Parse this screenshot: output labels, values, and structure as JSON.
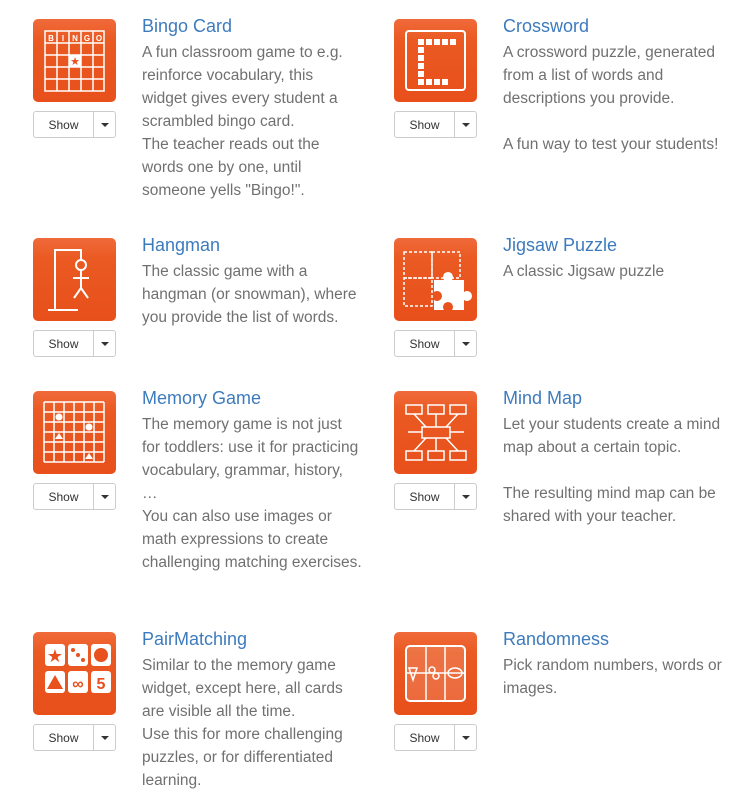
{
  "colors": {
    "accent": "#e8501d",
    "title": "#3d7bbd",
    "text": "#707070"
  },
  "widgets": [
    {
      "title": "Bingo Card",
      "icon": "bingo-card-icon",
      "button": "Show",
      "desc": [
        "A fun classroom game to e.g. reinforce vocabulary, this widget gives every student a scrambled bingo card.",
        "The teacher reads out the words one by one, until someone yells \"Bingo!\"."
      ]
    },
    {
      "title": "Crossword",
      "icon": "crossword-icon",
      "button": "Show",
      "desc": [
        "A crossword puzzle, generated from a list of words and descriptions you provide.",
        "",
        "A fun way to test your students!"
      ]
    },
    {
      "title": "Hangman",
      "icon": "hangman-icon",
      "button": "Show",
      "desc": [
        "The classic game with a hangman (or snowman), where you provide the list of words."
      ]
    },
    {
      "title": "Jigsaw Puzzle",
      "icon": "jigsaw-puzzle-icon",
      "button": "Show",
      "desc": [
        "A classic Jigsaw puzzle"
      ]
    },
    {
      "title": "Memory Game",
      "icon": "memory-game-icon",
      "button": "Show",
      "desc": [
        "The memory game is not just for toddlers: use it for practicing vocabulary, grammar, history, …",
        "You can also use images or math expressions to create challenging matching exercises."
      ]
    },
    {
      "title": "Mind Map",
      "icon": "mind-map-icon",
      "button": "Show",
      "desc": [
        "Let your students create a mind map about a certain topic.",
        "",
        "The resulting mind map can be shared with your teacher."
      ]
    },
    {
      "title": "PairMatching",
      "icon": "pair-matching-icon",
      "button": "Show",
      "desc": [
        "Similar to the memory game widget, except here, all cards are visible all the time.",
        "Use this for more challenging puzzles, or for differentiated learning."
      ]
    },
    {
      "title": "Randomness",
      "icon": "randomness-icon",
      "button": "Show",
      "desc": [
        "Pick random numbers, words or images."
      ]
    }
  ],
  "bingo_letters": "BINGO",
  "pair_labels": [
    "∞",
    "5"
  ]
}
